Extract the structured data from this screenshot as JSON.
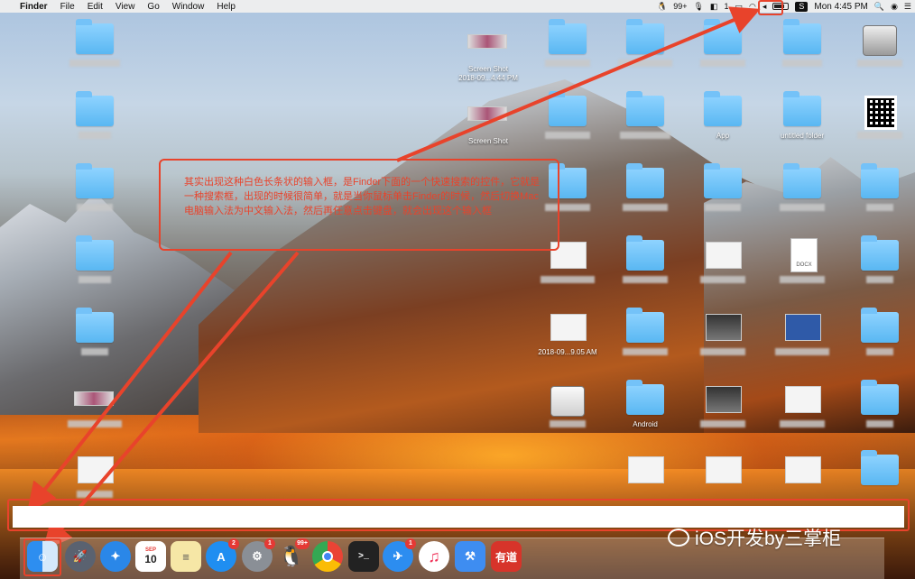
{
  "menubar": {
    "apple": "",
    "app_name": "Finder",
    "menus": [
      "File",
      "Edit",
      "View",
      "Go",
      "Window",
      "Help"
    ],
    "status": {
      "qq_count": "99+",
      "notif_count": "1",
      "input_method": "S",
      "clock": "Mon 4:45 PM"
    }
  },
  "desktop": {
    "screenshot1": {
      "line1": "Screen Shot",
      "line2": "2018-09...4.44 PM"
    },
    "screenshot2": {
      "line1": "Screen Shot",
      "line2": ""
    },
    "app_label": "App",
    "untitled_folder": "untitled folder",
    "docx": "DOCX",
    "android": "Android",
    "screenshot3": "2018-09...9.05 AM"
  },
  "annotation": {
    "text": "其实出现这种白色长条状的输入框，是Finder下面的一个快速搜索的控件，它就是一种搜索框，出现的时候很简单，就是当你鼠标单击Finder的时候，然后切换Mac电脑输入法为中文输入法，然后再任意点击键盘，就会出现这个输入框"
  },
  "search": {
    "value": "",
    "placeholder": ""
  },
  "dock": {
    "badges": {
      "appstore": "2",
      "prefs": "1",
      "qq": "99+",
      "wechat": "1"
    },
    "calendar": {
      "month": "SEP",
      "day": "10"
    },
    "youdao": "有道"
  },
  "watermark": "iOS开发by三掌柜",
  "colors": {
    "annotation_red": "#e8432b",
    "folder_blue": "#6ec3f7"
  }
}
